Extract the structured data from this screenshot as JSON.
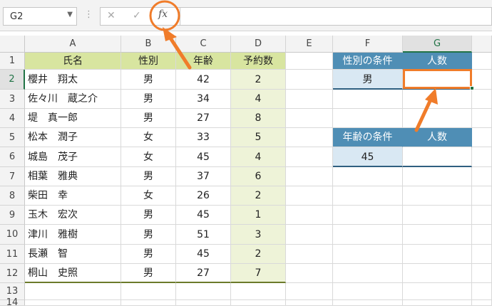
{
  "name_box": "G2",
  "columns": [
    "A",
    "B",
    "C",
    "D",
    "E",
    "F",
    "G"
  ],
  "rows": [
    "1",
    "2",
    "3",
    "4",
    "5",
    "6",
    "7",
    "8",
    "9",
    "10",
    "11",
    "12",
    "13",
    "14"
  ],
  "table_headers": [
    "氏名",
    "性別",
    "年齢",
    "予約数"
  ],
  "table_rows": [
    [
      "櫻井　翔太",
      "男",
      "42",
      "2"
    ],
    [
      "佐々川　蔵之介",
      "男",
      "34",
      "4"
    ],
    [
      "堤　真一郎",
      "男",
      "27",
      "8"
    ],
    [
      "松本　潤子",
      "女",
      "33",
      "5"
    ],
    [
      "城島　茂子",
      "女",
      "45",
      "4"
    ],
    [
      "相葉　雅典",
      "男",
      "37",
      "6"
    ],
    [
      "柴田　幸",
      "女",
      "26",
      "2"
    ],
    [
      "玉木　宏次",
      "男",
      "45",
      "1"
    ],
    [
      "津川　雅樹",
      "男",
      "51",
      "3"
    ],
    [
      "長瀬　智",
      "男",
      "45",
      "2"
    ],
    [
      "桐山　史照",
      "男",
      "27",
      "7"
    ]
  ],
  "criteria1": {
    "header_f": "性別の条件",
    "header_g": "人数",
    "value_f": "男",
    "value_g": ""
  },
  "criteria2": {
    "header_f": "年齢の条件",
    "header_g": "人数",
    "value_f": "45",
    "value_g": ""
  },
  "icons": {
    "cancel": "✕",
    "enter": "✓",
    "fx": "fx",
    "dropdown": "▼",
    "more": "⋮"
  },
  "colors": {
    "accent": "#f07c2a",
    "table_header": "#d8e5a0",
    "criteria_header": "#4f8eb5",
    "criteria_cell": "#d9e8f3",
    "selection": "#217346"
  }
}
